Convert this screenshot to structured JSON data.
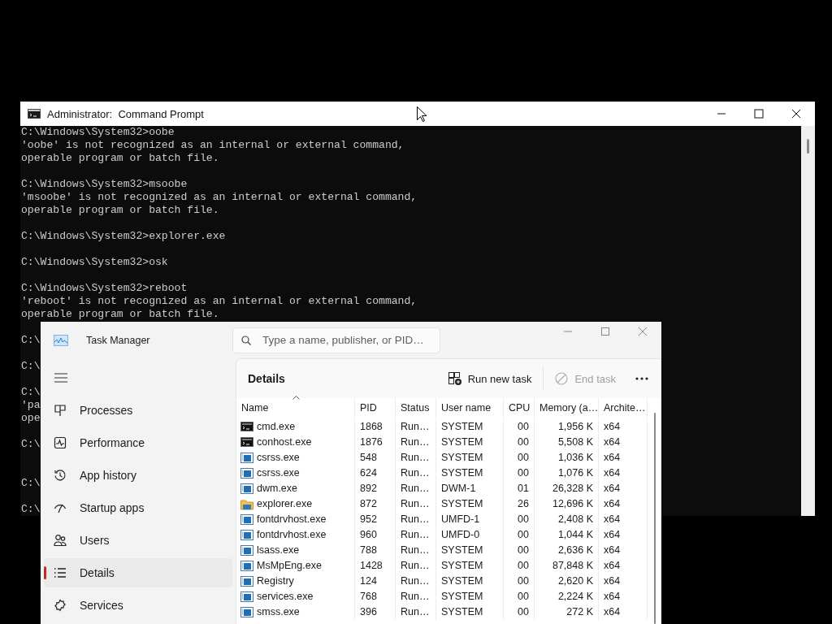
{
  "cmd": {
    "title": "Administrator:  Command Prompt",
    "paragraphs": [
      {
        "lines": [
          "C:\\Windows\\System32>oobe",
          "'oobe' is not recognized as an internal or external command,",
          "operable program or batch file."
        ],
        "extra_space": false
      },
      {
        "lines": [
          "C:\\Windows\\System32>msoobe",
          "'msoobe' is not recognized as an internal or external command,",
          "operable program or batch file."
        ],
        "extra_space": false
      },
      {
        "lines": [
          "C:\\Windows\\System32>explorer.exe"
        ],
        "extra_space": false
      },
      {
        "lines": [
          "C:\\Windows\\System32>osk"
        ],
        "extra_space": false
      },
      {
        "lines": [
          "C:\\Windows\\System32>reboot",
          "'reboot' is not recognized as an internal or external command,",
          "operable program or batch file."
        ],
        "extra_space": false
      },
      {
        "lines": [
          "C:\\"
        ],
        "extra_space": false
      },
      {
        "lines": [
          "C:\\"
        ],
        "extra_space": false
      },
      {
        "lines": [
          "C:\\",
          "'pa",
          "ope"
        ],
        "extra_space": false
      },
      {
        "lines": [
          "C:\\"
        ],
        "extra_space": true
      },
      {
        "lines": [
          "C:\\"
        ],
        "extra_space": false
      },
      {
        "lines": [
          "C:\\"
        ],
        "extra_space": false
      }
    ]
  },
  "task_manager": {
    "title": "Task Manager",
    "search": {
      "placeholder": "Type a name, publisher, or PID…"
    },
    "nav": [
      {
        "label": "Processes",
        "kind": "processes",
        "selected": false
      },
      {
        "label": "Performance",
        "kind": "performance",
        "selected": false
      },
      {
        "label": "App history",
        "kind": "history",
        "selected": false
      },
      {
        "label": "Startup apps",
        "kind": "startup",
        "selected": false
      },
      {
        "label": "Users",
        "kind": "users",
        "selected": false
      },
      {
        "label": "Details",
        "kind": "details",
        "selected": true
      },
      {
        "label": "Services",
        "kind": "services",
        "selected": false
      }
    ],
    "page_title": "Details",
    "actions": [
      {
        "label": "Run new task",
        "kind": "run",
        "disabled": false
      },
      {
        "label": "End task",
        "kind": "end",
        "disabled": true
      }
    ],
    "table": {
      "columns": [
        {
          "label": "Name",
          "sorted": true
        },
        {
          "label": "PID",
          "sorted": false
        },
        {
          "label": "Status",
          "sorted": false
        },
        {
          "label": "User name",
          "sorted": false
        },
        {
          "label": "CPU",
          "sorted": false
        },
        {
          "label": "Memory (a…",
          "sorted": false
        },
        {
          "label": "Archite…",
          "sorted": false
        }
      ],
      "rows": [
        {
          "kind": "console",
          "cells": [
            "cmd.exe",
            "1868",
            "Run…",
            "SYSTEM",
            "00",
            "1,956 K",
            "x64"
          ]
        },
        {
          "kind": "console",
          "cells": [
            "conhost.exe",
            "1876",
            "Run…",
            "SYSTEM",
            "00",
            "5,508 K",
            "x64"
          ]
        },
        {
          "kind": "app",
          "cells": [
            "csrss.exe",
            "548",
            "Run…",
            "SYSTEM",
            "00",
            "1,036 K",
            "x64"
          ]
        },
        {
          "kind": "app",
          "cells": [
            "csrss.exe",
            "624",
            "Run…",
            "SYSTEM",
            "00",
            "1,076 K",
            "x64"
          ]
        },
        {
          "kind": "app",
          "cells": [
            "dwm.exe",
            "892",
            "Run…",
            "DWM-1",
            "01",
            "26,328 K",
            "x64"
          ]
        },
        {
          "kind": "folder",
          "cells": [
            "explorer.exe",
            "872",
            "Run…",
            "SYSTEM",
            "26",
            "12,696 K",
            "x64"
          ]
        },
        {
          "kind": "app",
          "cells": [
            "fontdrvhost.exe",
            "952",
            "Run…",
            "UMFD-1",
            "00",
            "2,408 K",
            "x64"
          ]
        },
        {
          "kind": "app",
          "cells": [
            "fontdrvhost.exe",
            "960",
            "Run…",
            "UMFD-0",
            "00",
            "1,044 K",
            "x64"
          ]
        },
        {
          "kind": "app",
          "cells": [
            "lsass.exe",
            "788",
            "Run…",
            "SYSTEM",
            "00",
            "2,636 K",
            "x64"
          ]
        },
        {
          "kind": "app",
          "cells": [
            "MsMpEng.exe",
            "1428",
            "Run…",
            "SYSTEM",
            "00",
            "87,848 K",
            "x64"
          ]
        },
        {
          "kind": "app",
          "cells": [
            "Registry",
            "124",
            "Run…",
            "SYSTEM",
            "00",
            "2,620 K",
            "x64"
          ]
        },
        {
          "kind": "app",
          "cells": [
            "services.exe",
            "768",
            "Run…",
            "SYSTEM",
            "00",
            "2,224 K",
            "x64"
          ]
        },
        {
          "kind": "app",
          "cells": [
            "smss.exe",
            "396",
            "Run…",
            "SYSTEM",
            "00",
            "272 K",
            "x64"
          ]
        }
      ]
    }
  }
}
